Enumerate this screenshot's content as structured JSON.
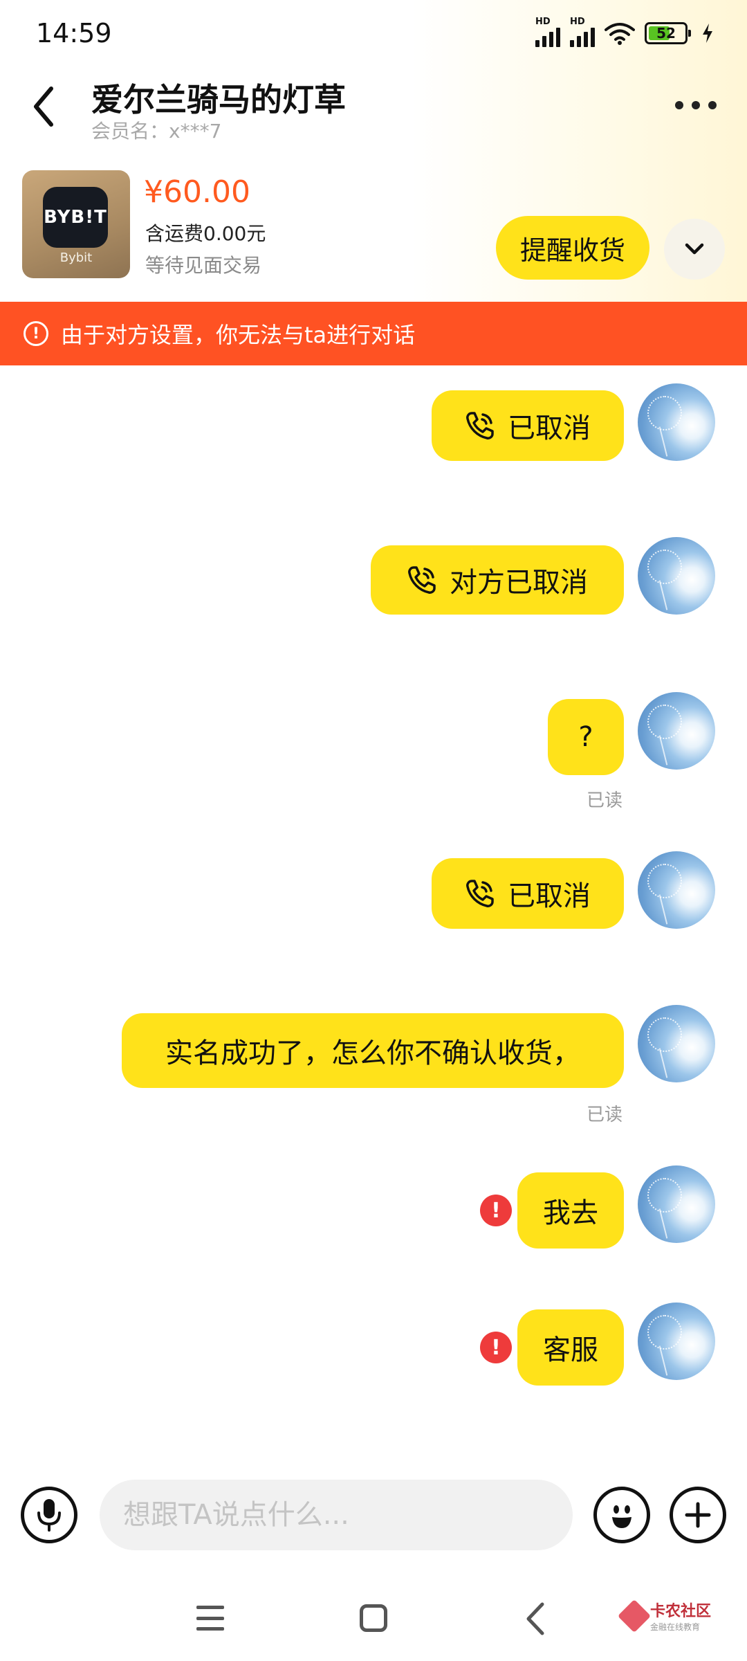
{
  "status_bar": {
    "time": "14:59",
    "hd1": "HD",
    "hd2": "HD",
    "battery": "52"
  },
  "header": {
    "title": "爱尔兰骑马的灯草",
    "member_label": "会员名：",
    "member_name": "x***7"
  },
  "product": {
    "logo_text": "BYB!T",
    "app_name": "Bybit",
    "price": "¥60.00",
    "shipping": "含运费0.00元",
    "status": "等待见面交易",
    "remind_button": "提醒收货"
  },
  "warning": {
    "text": "由于对方设置，你无法与ta进行对话"
  },
  "messages": [
    {
      "type": "call",
      "text": "已取消"
    },
    {
      "type": "call",
      "text": "对方已取消"
    },
    {
      "type": "text",
      "text": "?",
      "read": "已读"
    },
    {
      "type": "call",
      "text": "已取消"
    },
    {
      "type": "text",
      "text": "实名成功了，怎么你不确认收货，",
      "read": "已读"
    },
    {
      "type": "text",
      "text": "我去",
      "failed": "!"
    },
    {
      "type": "text",
      "text": "客服",
      "failed": "!"
    }
  ],
  "input": {
    "placeholder": "想跟TA说点什么..."
  },
  "watermark": {
    "title": "卡农社区",
    "subtitle": "金融在线教育"
  },
  "colors": {
    "accent": "#ffe21a",
    "warning": "#ff5223",
    "price": "#ff5a1f",
    "error": "#ee3b3b"
  }
}
